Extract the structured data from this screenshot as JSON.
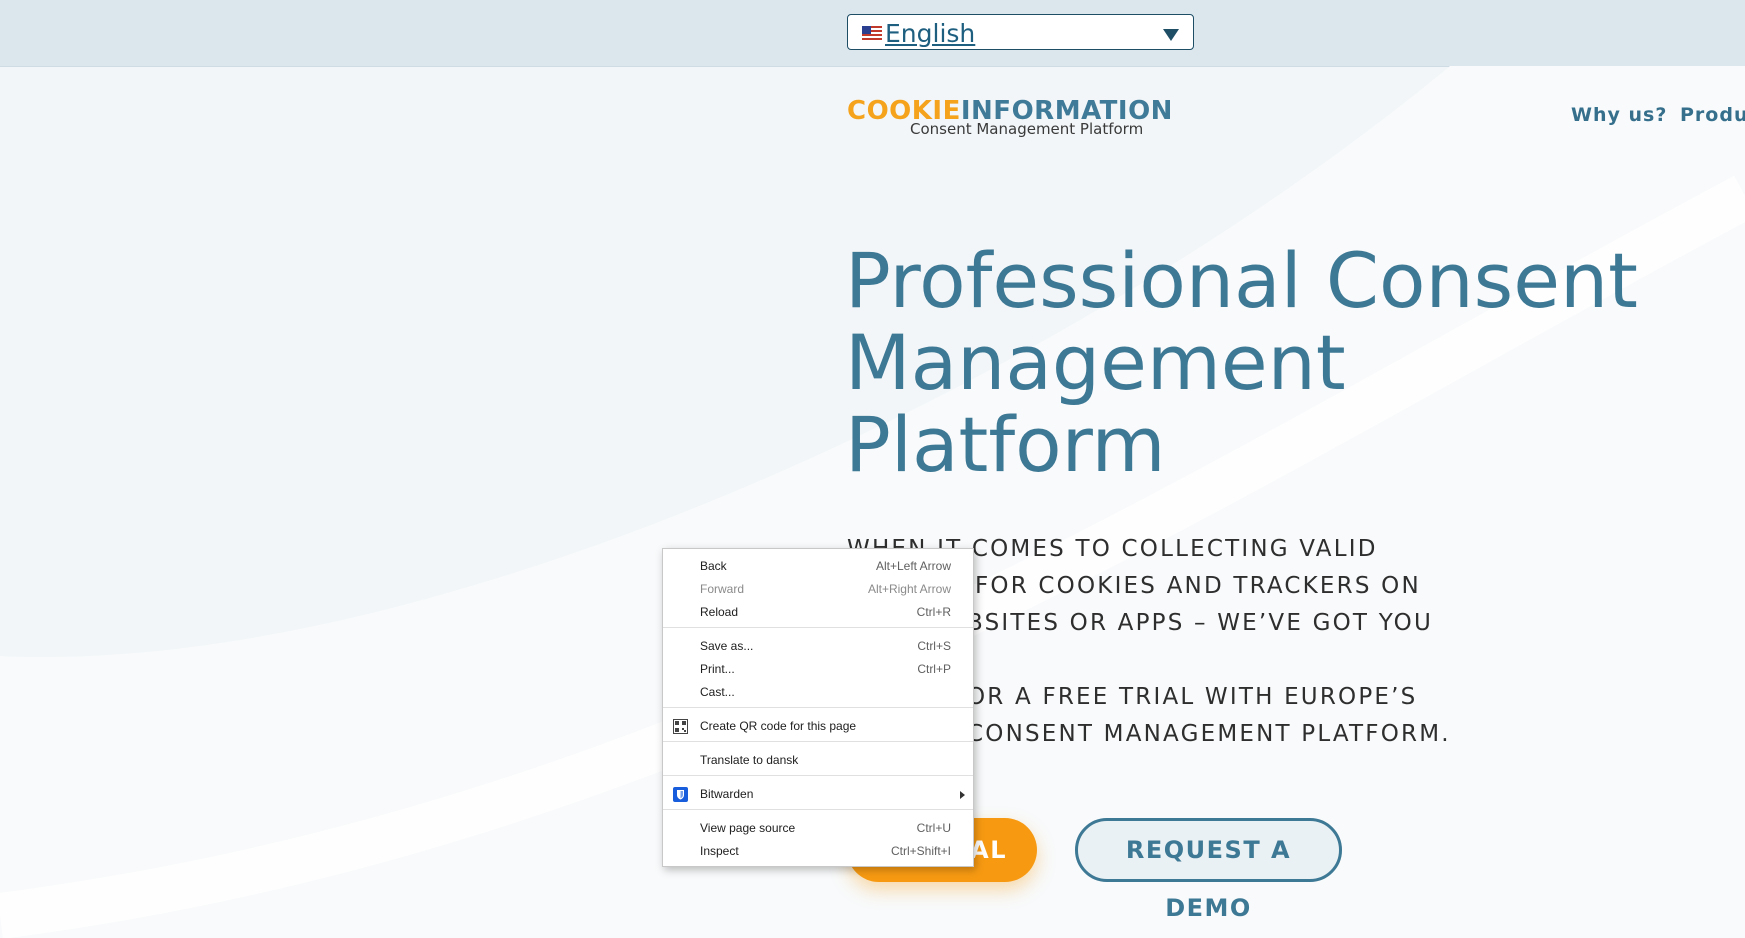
{
  "language_selector": {
    "value": "English"
  },
  "logo": {
    "brand_part1": "COOKIE",
    "brand_part2": "INFORMATION",
    "tagline": "Consent Management Platform"
  },
  "nav": {
    "items": [
      "Why us?",
      "Produ"
    ]
  },
  "hero": {
    "title_lines": [
      "Professional Consent",
      "Management",
      "Platform"
    ],
    "body_lines": [
      "WHEN IT COMES TO COLLECTING VALID",
      "FOR COOKIES AND TRACKERS ON",
      "BSITES OR APPS – WE’VE GOT YOU",
      "OR A FREE TRIAL WITH EUROPE’S",
      "CONSENT MANAGEMENT PLATFORM."
    ],
    "trial_button": "IAL",
    "demo_button": "REQUEST A DEMO"
  },
  "context_menu": {
    "items": [
      {
        "label": "Back",
        "shortcut": "Alt+Left Arrow"
      },
      {
        "label": "Forward",
        "shortcut": "Alt+Right Arrow",
        "disabled": true
      },
      {
        "label": "Reload",
        "shortcut": "Ctrl+R"
      },
      {
        "label": "Save as...",
        "shortcut": "Ctrl+S"
      },
      {
        "label": "Print...",
        "shortcut": "Ctrl+P"
      },
      {
        "label": "Cast...",
        "shortcut": ""
      },
      {
        "label": "Create QR code for this page",
        "icon": "qr-code-icon"
      },
      {
        "label": "Translate to dansk"
      },
      {
        "label": "Bitwarden",
        "icon": "bitwarden-shield-icon",
        "submenu": true
      },
      {
        "label": "View page source",
        "shortcut": "Ctrl+U"
      },
      {
        "label": "Inspect",
        "shortcut": "Ctrl+Shift+I"
      }
    ]
  },
  "colors": {
    "accent_orange": "#f79a12",
    "brand_blue": "#3d7894",
    "background": "#f2f6f8"
  }
}
